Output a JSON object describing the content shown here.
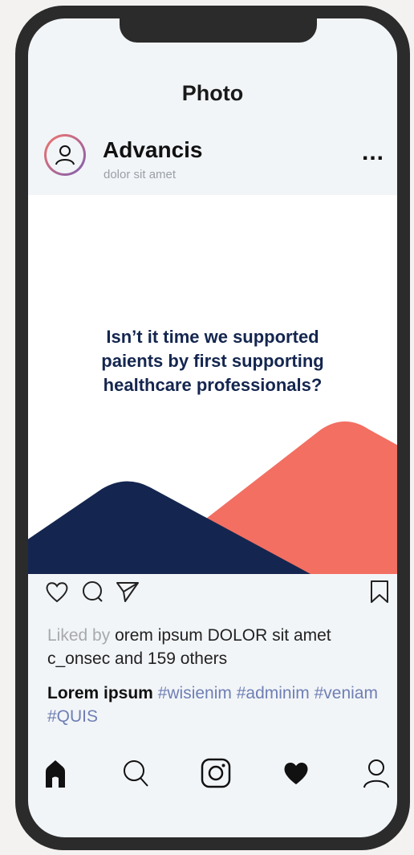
{
  "screen": {
    "title": "Photo"
  },
  "post": {
    "username": "Advancis",
    "subline": "dolor sit amet",
    "more_label": "...",
    "image_text": "Isn’t it time we supported paients by first supporting healthcare professionals?",
    "colors": {
      "navy": "#14264f",
      "coral": "#f26f62"
    }
  },
  "likes": {
    "prefix": "Liked by",
    "text": "orem ipsum DOLOR sit amet c_onsec and 159 others"
  },
  "caption": {
    "author": "Lorem ipsum",
    "hashtags": "#wisienim #adminim #veniam #QUIS"
  },
  "icons": {
    "actions": [
      "heart-outline-icon",
      "comment-icon",
      "share-icon",
      "bookmark-icon"
    ],
    "nav": [
      "home-icon",
      "search-icon",
      "camera-icon",
      "heart-filled-icon",
      "profile-icon"
    ]
  }
}
